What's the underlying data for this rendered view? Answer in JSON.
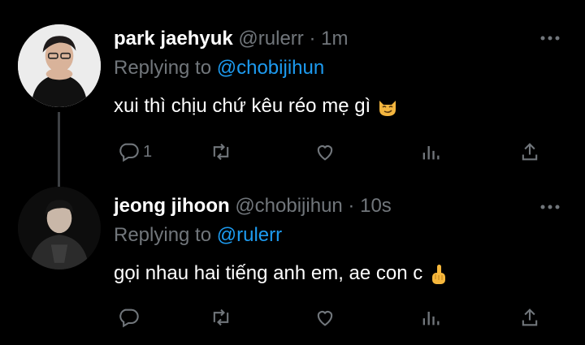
{
  "tweets": [
    {
      "display_name": "park jaehyuk",
      "handle": "@rulerr",
      "separator": " · ",
      "time": "1m",
      "reply_label": "Replying to ",
      "reply_to": "@chobijihun",
      "text": "xui thì chịu chứ kêu réo mẹ gì",
      "emoji": "smirking-cat",
      "reply_count": "1",
      "avatar": "profile-photo"
    },
    {
      "display_name": "jeong jihoon",
      "handle": "@chobijihun",
      "separator": " · ",
      "time": "10s",
      "reply_label": "Replying to ",
      "reply_to": "@rulerr",
      "text": "gọi nhau hai tiếng anh em, ae con c",
      "emoji": "pointing-hand",
      "reply_count": "",
      "avatar": "profile-photo"
    }
  ],
  "icons": [
    "more-icon",
    "reply-icon",
    "retweet-icon",
    "like-icon",
    "stats-icon",
    "share-icon"
  ],
  "colors": {
    "background": "#000000",
    "text": "#e7e9ea",
    "muted": "#71767b",
    "link": "#1d9bf0",
    "thread_line": "#3e4144"
  }
}
